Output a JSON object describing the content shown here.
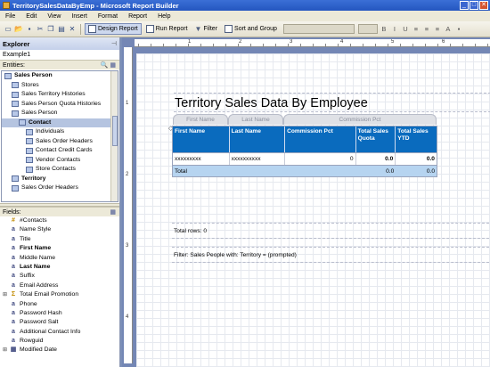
{
  "window": {
    "title": "TerritorySalesDataByEmp - Microsoft Report Builder",
    "controls": [
      "_",
      "□",
      "✕"
    ]
  },
  "menu": [
    "File",
    "Edit",
    "View",
    "Insert",
    "Format",
    "Report",
    "Help"
  ],
  "toolbar": {
    "design_report": "Design Report",
    "run_report": "Run Report",
    "filter": "Filter",
    "sort_and_group": "Sort and Group"
  },
  "explorer": {
    "title": "Explorer",
    "model": "Example1",
    "entities_label": "Entities:",
    "entities": [
      {
        "label": "Sales Person",
        "level": 0,
        "bold": true,
        "selected": false
      },
      {
        "label": "Stores",
        "level": 1,
        "bold": false,
        "selected": false
      },
      {
        "label": "Sales Territory Histories",
        "level": 1,
        "bold": false,
        "selected": false
      },
      {
        "label": "Sales Person Quota Histories",
        "level": 1,
        "bold": false,
        "selected": false
      },
      {
        "label": "Sales Person",
        "level": 1,
        "bold": false,
        "selected": false
      },
      {
        "label": "Contact",
        "level": 2,
        "bold": true,
        "selected": true
      },
      {
        "label": "Individuals",
        "level": 3,
        "bold": false,
        "selected": false
      },
      {
        "label": "Sales Order Headers",
        "level": 3,
        "bold": false,
        "selected": false
      },
      {
        "label": "Contact Credit Cards",
        "level": 3,
        "bold": false,
        "selected": false
      },
      {
        "label": "Vendor Contacts",
        "level": 3,
        "bold": false,
        "selected": false
      },
      {
        "label": "Store Contacts",
        "level": 3,
        "bold": false,
        "selected": false
      },
      {
        "label": "Territory",
        "level": 1,
        "bold": true,
        "selected": false
      },
      {
        "label": "Sales Order Headers",
        "level": 1,
        "bold": false,
        "selected": false
      }
    ],
    "fields_label": "Fields:",
    "fields": [
      {
        "label": "#Contacts",
        "icon": "#",
        "bold": false,
        "expand": false
      },
      {
        "label": "Name Style",
        "icon": "a",
        "bold": false,
        "expand": false
      },
      {
        "label": "Title",
        "icon": "a",
        "bold": false,
        "expand": false
      },
      {
        "label": "First Name",
        "icon": "a",
        "bold": true,
        "expand": false
      },
      {
        "label": "Middle Name",
        "icon": "a",
        "bold": false,
        "expand": false
      },
      {
        "label": "Last Name",
        "icon": "a",
        "bold": true,
        "expand": false
      },
      {
        "label": "Suffix",
        "icon": "a",
        "bold": false,
        "expand": false
      },
      {
        "label": "Email Address",
        "icon": "a",
        "bold": false,
        "expand": false
      },
      {
        "label": "Total Email Promotion",
        "icon": "Σ",
        "bold": false,
        "expand": true
      },
      {
        "label": "Phone",
        "icon": "a",
        "bold": false,
        "expand": false
      },
      {
        "label": "Password Hash",
        "icon": "a",
        "bold": false,
        "expand": false
      },
      {
        "label": "Password Salt",
        "icon": "a",
        "bold": false,
        "expand": false
      },
      {
        "label": "Additional Contact Info",
        "icon": "a",
        "bold": false,
        "expand": false
      },
      {
        "label": "Rowguid",
        "icon": "a",
        "bold": false,
        "expand": false
      },
      {
        "label": "Modified Date",
        "icon": "▦",
        "bold": false,
        "expand": true
      }
    ]
  },
  "ruler": {
    "top": [
      "1",
      "2",
      "3",
      "4",
      "5",
      "6"
    ],
    "left": [
      "1",
      "2",
      "3",
      "4"
    ]
  },
  "report": {
    "title": "Territory Sales Data By Employee",
    "group_tabs": [
      "First Name",
      "Last Name",
      "Commission Pct"
    ],
    "columns": [
      "First Name",
      "Last Name",
      "Commission Pct",
      "Total Sales Quota",
      "Total Sales YTD"
    ],
    "detail": [
      "xxxxxxxxx",
      "xxxxxxxxxx",
      "0",
      "0.0",
      "0.0"
    ],
    "total_row": [
      "Total",
      "",
      "",
      "0.0",
      "0.0"
    ],
    "total_rows_text": "Total rows: 0",
    "filter_text": "Filter: Sales People with: Territory = (prompted)"
  }
}
